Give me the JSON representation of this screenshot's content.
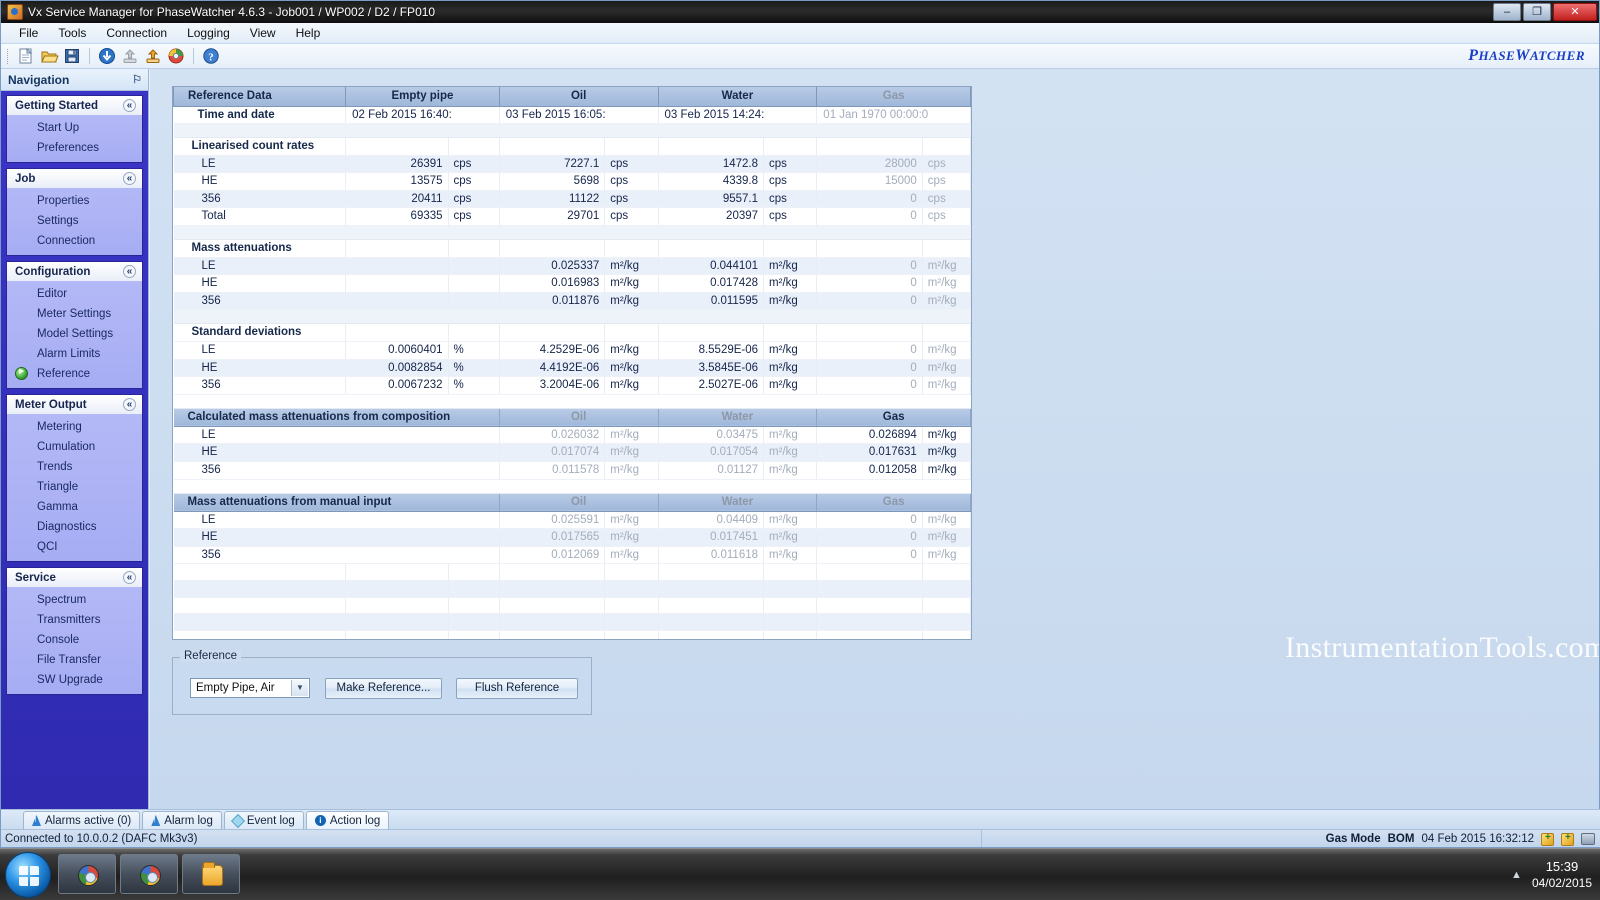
{
  "window": {
    "title": "Vx Service Manager for PhaseWatcher 4.6.3 - Job001 / WP002 / D2 / FP010",
    "minimize": "–",
    "maximize": "❐",
    "close": "✕",
    "brand_main": "P",
    "brand": "HASE",
    "brand_w": "W",
    "brand_tail": "ATCHER"
  },
  "menubar": {
    "items": [
      "File",
      "Tools",
      "Connection",
      "Logging",
      "View",
      "Help"
    ]
  },
  "toolbar": {
    "icons": [
      "new-document-icon",
      "open-folder-icon",
      "save-disk-icon",
      "download-icon",
      "upload-grey-icon",
      "upload-icon",
      "refresh-icon",
      "help-icon"
    ]
  },
  "navigation": {
    "header": "Navigation",
    "pin": "⚐",
    "collapse_glyph": "«",
    "groups": [
      {
        "title": "Getting Started",
        "items": [
          {
            "label": "Start Up",
            "active": false
          },
          {
            "label": "Preferences",
            "active": false
          }
        ]
      },
      {
        "title": "Job",
        "items": [
          {
            "label": "Properties",
            "active": false
          },
          {
            "label": "Settings",
            "active": false
          },
          {
            "label": "Connection",
            "active": false
          }
        ]
      },
      {
        "title": "Configuration",
        "items": [
          {
            "label": "Editor",
            "active": false
          },
          {
            "label": "Meter Settings",
            "active": false
          },
          {
            "label": "Model Settings",
            "active": false
          },
          {
            "label": "Alarm Limits",
            "active": false
          },
          {
            "label": "Reference",
            "active": true
          }
        ]
      },
      {
        "title": "Meter Output",
        "items": [
          {
            "label": "Metering",
            "active": false
          },
          {
            "label": "Cumulation",
            "active": false
          },
          {
            "label": "Trends",
            "active": false
          },
          {
            "label": "Triangle",
            "active": false
          },
          {
            "label": "Gamma",
            "active": false
          },
          {
            "label": "Diagnostics",
            "active": false
          },
          {
            "label": "QCI",
            "active": false
          }
        ]
      },
      {
        "title": "Service",
        "items": [
          {
            "label": "Spectrum",
            "active": false
          },
          {
            "label": "Transmitters",
            "active": false
          },
          {
            "label": "Console",
            "active": false
          },
          {
            "label": "File Transfer",
            "active": false
          },
          {
            "label": "SW Upgrade",
            "active": false
          }
        ]
      }
    ]
  },
  "grid": {
    "headers": [
      "Reference Data",
      "Empty pipe",
      "Oil",
      "Water",
      "Gas"
    ],
    "rows": [
      {
        "type": "data",
        "label": "Time and date",
        "bold": true,
        "cells": [
          {
            "v": "02 Feb 2015 16:40:",
            "u": ""
          },
          {
            "v": "03 Feb 2015 16:05:",
            "u": ""
          },
          {
            "v": "03 Feb 2015 14:24:",
            "u": ""
          },
          {
            "v": "01 Jan 1970 00:00:0",
            "u": "",
            "dim": true
          }
        ],
        "datetime": true
      },
      {
        "type": "spacer"
      },
      {
        "type": "section",
        "label": "Linearised count rates"
      },
      {
        "type": "data",
        "label": "LE",
        "alt": true,
        "cells": [
          {
            "v": "26391",
            "u": "cps"
          },
          {
            "v": "7227.1",
            "u": "cps"
          },
          {
            "v": "1472.8",
            "u": "cps"
          },
          {
            "v": "28000",
            "u": "cps",
            "dim": true
          }
        ]
      },
      {
        "type": "data",
        "label": "HE",
        "cells": [
          {
            "v": "13575",
            "u": "cps"
          },
          {
            "v": "5698",
            "u": "cps"
          },
          {
            "v": "4339.8",
            "u": "cps"
          },
          {
            "v": "15000",
            "u": "cps",
            "dim": true
          }
        ]
      },
      {
        "type": "data",
        "label": "356",
        "alt": true,
        "cells": [
          {
            "v": "20411",
            "u": "cps"
          },
          {
            "v": "11122",
            "u": "cps"
          },
          {
            "v": "9557.1",
            "u": "cps"
          },
          {
            "v": "0",
            "u": "cps",
            "dim": true
          }
        ]
      },
      {
        "type": "data",
        "label": "Total",
        "cells": [
          {
            "v": "69335",
            "u": "cps"
          },
          {
            "v": "29701",
            "u": "cps"
          },
          {
            "v": "20397",
            "u": "cps"
          },
          {
            "v": "0",
            "u": "cps",
            "dim": true
          }
        ]
      },
      {
        "type": "spacer"
      },
      {
        "type": "section",
        "label": "Mass attenuations"
      },
      {
        "type": "data",
        "label": "LE",
        "alt": true,
        "cells": [
          {
            "v": "",
            "u": ""
          },
          {
            "v": "0.025337",
            "u": "m²/kg"
          },
          {
            "v": "0.044101",
            "u": "m²/kg"
          },
          {
            "v": "0",
            "u": "m²/kg",
            "dim": true
          }
        ]
      },
      {
        "type": "data",
        "label": "HE",
        "cells": [
          {
            "v": "",
            "u": ""
          },
          {
            "v": "0.016983",
            "u": "m²/kg"
          },
          {
            "v": "0.017428",
            "u": "m²/kg"
          },
          {
            "v": "0",
            "u": "m²/kg",
            "dim": true
          }
        ]
      },
      {
        "type": "data",
        "label": "356",
        "alt": true,
        "cells": [
          {
            "v": "",
            "u": ""
          },
          {
            "v": "0.011876",
            "u": "m²/kg"
          },
          {
            "v": "0.011595",
            "u": "m²/kg"
          },
          {
            "v": "0",
            "u": "m²/kg",
            "dim": true
          }
        ]
      },
      {
        "type": "spacer"
      },
      {
        "type": "section",
        "label": "Standard deviations"
      },
      {
        "type": "data",
        "label": "LE",
        "cells": [
          {
            "v": "0.0060401",
            "u": "%"
          },
          {
            "v": "4.2529E-06",
            "u": "m²/kg"
          },
          {
            "v": "8.5529E-06",
            "u": "m²/kg"
          },
          {
            "v": "0",
            "u": "m²/kg",
            "dim": true
          }
        ]
      },
      {
        "type": "data",
        "label": "HE",
        "alt": true,
        "cells": [
          {
            "v": "0.0082854",
            "u": "%"
          },
          {
            "v": "4.4192E-06",
            "u": "m²/kg"
          },
          {
            "v": "3.5845E-06",
            "u": "m²/kg"
          },
          {
            "v": "0",
            "u": "m²/kg",
            "dim": true
          }
        ]
      },
      {
        "type": "data",
        "label": "356",
        "cells": [
          {
            "v": "0.0067232",
            "u": "%"
          },
          {
            "v": "3.2004E-06",
            "u": "m²/kg"
          },
          {
            "v": "2.5027E-06",
            "u": "m²/kg"
          },
          {
            "v": "0",
            "u": "m²/kg",
            "dim": true
          }
        ]
      },
      {
        "type": "spacer",
        "white": true
      }
    ],
    "section_calculated": {
      "title": "Calculated mass attenuations from composition",
      "col_headers": [
        "Oil",
        "Water",
        "Gas"
      ],
      "col_header_dim": [
        true,
        true,
        false
      ],
      "rows": [
        {
          "label": "LE",
          "cells": [
            {
              "v": "0.026032",
              "u": "m²/kg",
              "dim": true
            },
            {
              "v": "0.03475",
              "u": "m²/kg",
              "dim": true
            },
            {
              "v": "0.026894",
              "u": "m²/kg",
              "dim": false
            }
          ]
        },
        {
          "label": "HE",
          "alt": true,
          "cells": [
            {
              "v": "0.017074",
              "u": "m²/kg",
              "dim": true
            },
            {
              "v": "0.017054",
              "u": "m²/kg",
              "dim": true
            },
            {
              "v": "0.017631",
              "u": "m²/kg",
              "dim": false
            }
          ]
        },
        {
          "label": "356",
          "cells": [
            {
              "v": "0.011578",
              "u": "m²/kg",
              "dim": true
            },
            {
              "v": "0.01127",
              "u": "m²/kg",
              "dim": true
            },
            {
              "v": "0.012058",
              "u": "m²/kg",
              "dim": false
            }
          ]
        }
      ]
    },
    "section_manual": {
      "title": "Mass attenuations from manual input",
      "col_headers": [
        "Oil",
        "Water",
        "Gas"
      ],
      "col_header_dim": [
        true,
        true,
        true
      ],
      "rows": [
        {
          "label": "LE",
          "cells": [
            {
              "v": "0.025591",
              "u": "m²/kg",
              "dim": true
            },
            {
              "v": "0.04409",
              "u": "m²/kg",
              "dim": true
            },
            {
              "v": "0",
              "u": "m²/kg",
              "dim": true
            }
          ]
        },
        {
          "label": "HE",
          "alt": true,
          "cells": [
            {
              "v": "0.017565",
              "u": "m²/kg",
              "dim": true
            },
            {
              "v": "0.017451",
              "u": "m²/kg",
              "dim": true
            },
            {
              "v": "0",
              "u": "m²/kg",
              "dim": true
            }
          ]
        },
        {
          "label": "356",
          "cells": [
            {
              "v": "0.012069",
              "u": "m²/kg",
              "dim": true
            },
            {
              "v": "0.011618",
              "u": "m²/kg",
              "dim": true
            },
            {
              "v": "0",
              "u": "m²/kg",
              "dim": true
            }
          ]
        }
      ]
    }
  },
  "reference_panel": {
    "legend": "Reference",
    "select_value": "Empty Pipe, Air",
    "select_arrow": "▼",
    "make_button": "Make Reference...",
    "flush_button": "Flush Reference"
  },
  "bottom_tabs": [
    {
      "label": "Alarms active (0)",
      "icon": "alarm-icon",
      "active": false
    },
    {
      "label": "Alarm log",
      "icon": "alarm-icon",
      "active": false
    },
    {
      "label": "Event log",
      "icon": "diamond-icon",
      "active": false
    },
    {
      "label": "Action log",
      "icon": "info-icon",
      "active": true
    }
  ],
  "statusbar": {
    "left": "Connected to 10.0.0.2 (DAFC Mk3v3)",
    "gas_mode_label": "Gas Mode",
    "gas_mode_value": "BOM",
    "timestamp": "04 Feb 2015 16:32:12"
  },
  "watermark": "InstrumentationTools.com",
  "taskbar": {
    "tray_arrow": "▲",
    "clock_time": "15:39",
    "clock_date": "04/02/2015"
  }
}
